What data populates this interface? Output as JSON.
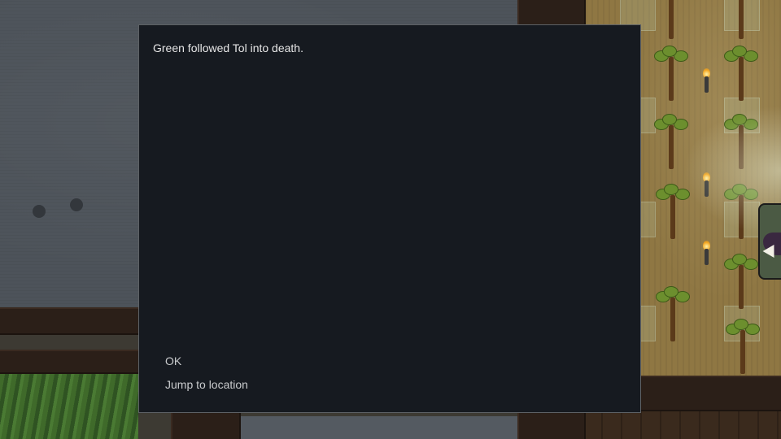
{
  "dialog": {
    "message": "Green followed Tol into death.",
    "options": [
      {
        "label": "OK"
      },
      {
        "label": "Jump to location"
      }
    ]
  },
  "colors": {
    "dialog_background": "#161a20",
    "dialog_border": "#5e6266",
    "message_text": "#e6e6e6",
    "option_text": "#c9cbcd"
  }
}
